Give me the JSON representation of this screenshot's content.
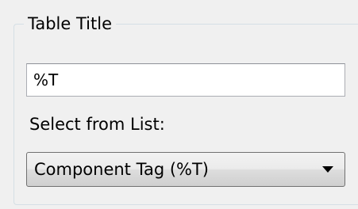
{
  "title_group": {
    "legend": "Table Title",
    "input_value": "%T",
    "list_label": "Select from List:",
    "selected_option": "Component Tag (%T)"
  },
  "icons": {
    "dropdown": "chevron-down-icon"
  }
}
